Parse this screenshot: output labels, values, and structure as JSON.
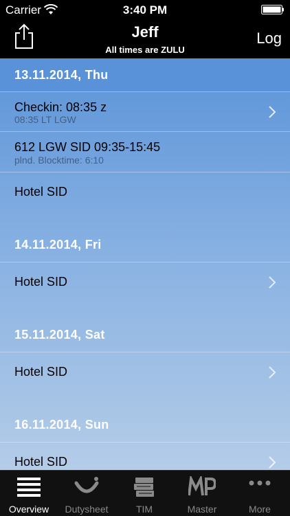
{
  "status_bar": {
    "carrier": "Carrier",
    "time": "3:40 PM"
  },
  "nav": {
    "title": "Jeff",
    "subtitle": "All times are ZULU",
    "log_label": "Log"
  },
  "days": [
    {
      "header": "13.11.2014,  Thu",
      "rows": [
        {
          "primary": "Checkin: 08:35 z",
          "secondary": "08:35 LT LGW",
          "chevron": true
        },
        {
          "primary": "612 LGW SID 09:35-15:45",
          "secondary": "plnd. Blocktime: 6:10",
          "chevron": false
        },
        {
          "primary": "Hotel SID",
          "chevron": false
        }
      ]
    },
    {
      "header": "14.11.2014,  Fri",
      "rows": [
        {
          "primary": "Hotel SID",
          "chevron": true
        }
      ]
    },
    {
      "header": "15.11.2014,  Sat",
      "rows": [
        {
          "primary": "Hotel SID",
          "chevron": true
        }
      ]
    },
    {
      "header": "16.11.2014,  Sun",
      "rows": [
        {
          "primary": "Hotel SID",
          "chevron": true
        }
      ]
    }
  ],
  "tabs": [
    {
      "label": "Overview",
      "icon": "list-icon",
      "active": true
    },
    {
      "label": "Dutysheet",
      "icon": "tui-smile-icon",
      "active": false
    },
    {
      "label": "TIM",
      "icon": "books-stack-icon",
      "active": false
    },
    {
      "label": "Master",
      "icon": "mp-logo-icon",
      "active": false
    },
    {
      "label": "More",
      "icon": "more-dots-icon",
      "active": false
    }
  ],
  "colors": {
    "header_blue": "#5a92d9",
    "bar_black": "#000000",
    "tab_active": "#ffffff",
    "tab_inactive": "#8a8a8a"
  }
}
